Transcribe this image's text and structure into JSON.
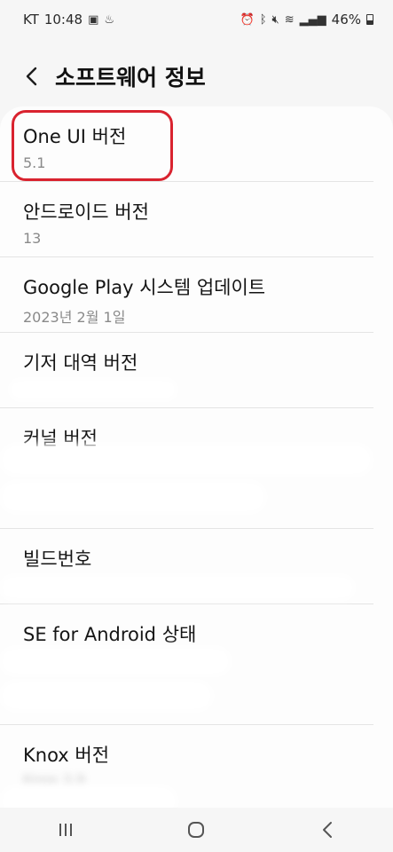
{
  "status": {
    "carrier": "KT",
    "time": "10:48",
    "battery": "46%"
  },
  "header": {
    "title": "소프트웨어 정보"
  },
  "items": [
    {
      "title": "One UI 버전",
      "value": "5.1"
    },
    {
      "title": "안드로이드 버전",
      "value": "13"
    },
    {
      "title": "Google Play 시스템 업데이트",
      "value": "2023년 2월 1일"
    },
    {
      "title": "기저 대역 버전",
      "value": ""
    },
    {
      "title": "커널 버전",
      "value": ""
    },
    {
      "title": "빌드번호",
      "value": ""
    },
    {
      "title": "SE for Android 상태",
      "value": ""
    },
    {
      "title": "Knox 버전",
      "value": "Knox 3.9"
    }
  ],
  "colors": {
    "highlight": "#d9232f",
    "background": "#f6f6f6",
    "card": "#fdfdfd"
  },
  "icons": {
    "back": "chevron-left-icon",
    "recent": "recent-apps-icon",
    "home": "home-icon",
    "nav_back": "nav-back-icon"
  }
}
